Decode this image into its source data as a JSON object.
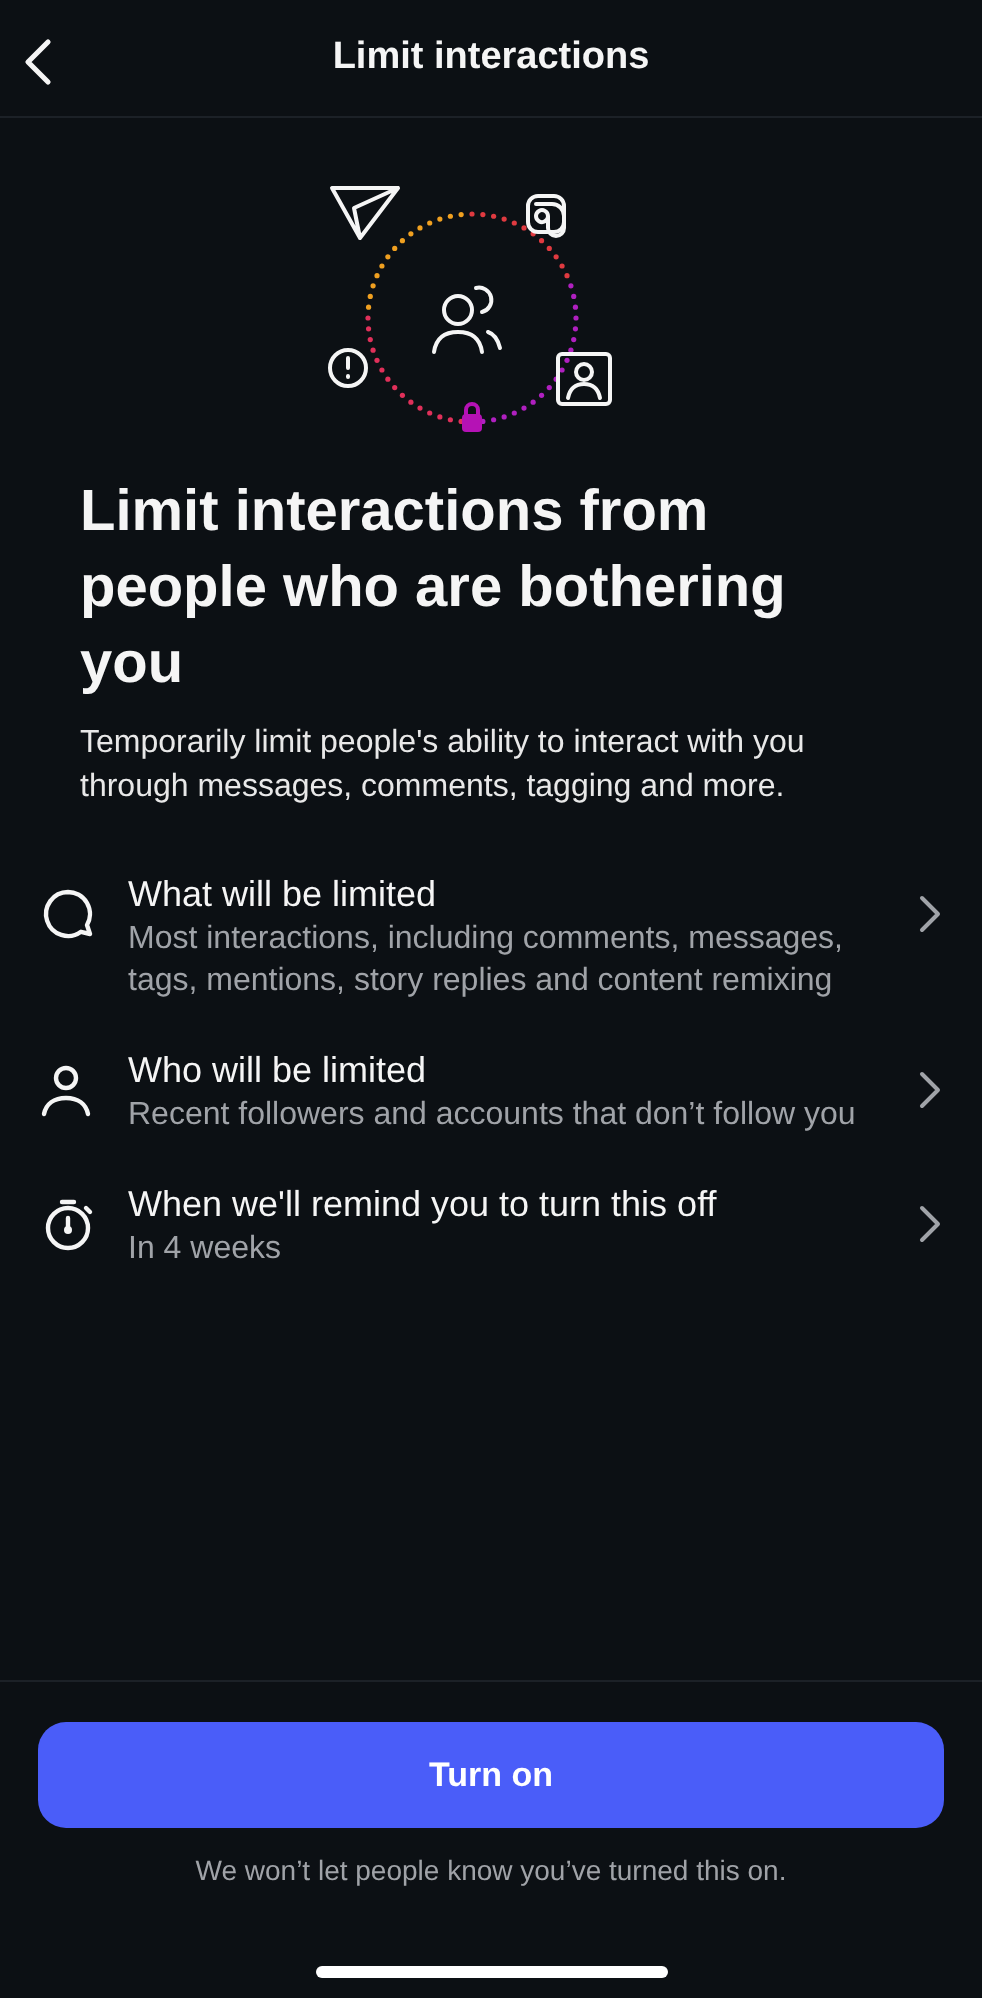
{
  "header": {
    "title": "Limit interactions"
  },
  "heading": "Limit interactions from people who are bothering you",
  "description": "Temporarily limit people's ability to interact with you through messages, comments, tagging and more.",
  "items": [
    {
      "kind": "chat",
      "title": "What will be limited",
      "detail": "Most interactions, including comments, messages, tags, mentions, story replies and content remixing"
    },
    {
      "kind": "person",
      "title": "Who will be limited",
      "detail": "Recent followers and accounts that don’t follow you"
    },
    {
      "kind": "timer",
      "title": "When we'll remind you to turn this off",
      "detail": "In 4 weeks"
    }
  ],
  "button": "Turn on",
  "note": "We won’t let people know you’ve turned this on."
}
